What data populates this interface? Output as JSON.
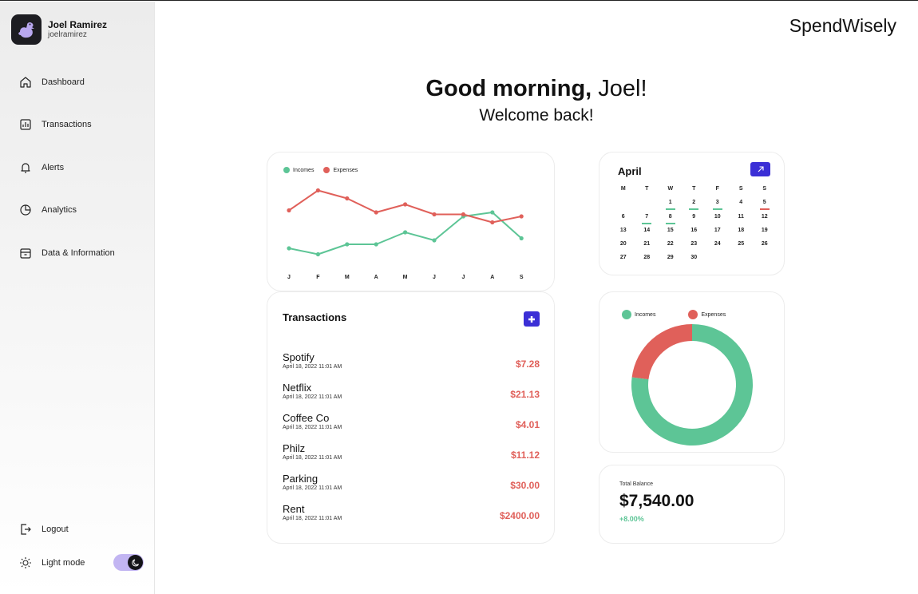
{
  "brand": "SpendWisely",
  "user": {
    "name": "Joel Ramirez",
    "handle": "joelramirez"
  },
  "nav": [
    {
      "label": "Dashboard",
      "icon": "home-icon"
    },
    {
      "label": "Transactions",
      "icon": "bar-chart-icon"
    },
    {
      "label": "Alerts",
      "icon": "bell-icon"
    },
    {
      "label": "Analytics",
      "icon": "pie-chart-icon"
    },
    {
      "label": "Data & Information",
      "icon": "archive-icon"
    }
  ],
  "logout_label": "Logout",
  "light_mode_label": "Light mode",
  "greeting": {
    "bold": "Good morning,",
    "name": " Joel!",
    "subtitle": "Welcome back!"
  },
  "colors": {
    "income": "#5dc596",
    "expense": "#e0605a",
    "accent": "#3b2fd6",
    "toggle": "#c2b5f2"
  },
  "legend": {
    "incomes": "Incomes",
    "expenses": "Expenses"
  },
  "chart_data": [
    {
      "type": "line",
      "categories": [
        "J",
        "F",
        "M",
        "A",
        "M",
        "J",
        "J",
        "A",
        "S"
      ],
      "series": [
        {
          "name": "Incomes",
          "values": [
            28,
            25,
            30,
            30,
            36,
            32,
            44,
            46,
            33
          ]
        },
        {
          "name": "Expenses",
          "values": [
            47,
            57,
            53,
            46,
            50,
            45,
            45,
            41,
            44
          ]
        }
      ],
      "ylim": [
        20,
        60
      ],
      "grid": false,
      "legend": "top-left"
    },
    {
      "type": "pie",
      "donut": true,
      "categories": [
        "Incomes",
        "Expenses"
      ],
      "values": [
        77,
        23
      ],
      "legend": "top"
    }
  ],
  "transactions": {
    "title": "Transactions",
    "items": [
      {
        "name": "Spotify",
        "date": "April 18, 2022 11:01 AM",
        "amount": "$7.28"
      },
      {
        "name": "Netflix",
        "date": "April 18, 2022 11:01 AM",
        "amount": "$21.13"
      },
      {
        "name": "Coffee Co",
        "date": "April 18, 2022 11:01 AM",
        "amount": "$4.01"
      },
      {
        "name": "Philz",
        "date": "April 18, 2022 11:01 AM",
        "amount": "$11.12"
      },
      {
        "name": "Parking",
        "date": "April 18, 2022 11:01 AM",
        "amount": "$30.00"
      },
      {
        "name": "Rent",
        "date": "April 18, 2022 11:01 AM",
        "amount": "$2400.00"
      }
    ]
  },
  "calendar": {
    "month": "April",
    "weekdays": [
      "M",
      "T",
      "W",
      "T",
      "F",
      "S",
      "S"
    ],
    "leading_blanks": 2,
    "days": 30,
    "income_days": [
      1,
      2,
      3,
      7,
      8
    ],
    "expense_days": [
      5
    ]
  },
  "balance": {
    "label": "Total Balance",
    "value": "$7,540.00",
    "change": "+8.00%"
  }
}
